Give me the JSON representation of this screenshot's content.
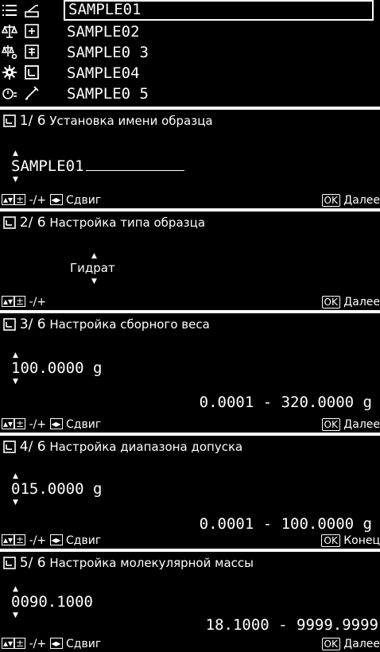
{
  "list_panel": {
    "items": [
      "SAMPLE01",
      "SAMPLE02",
      "SAMPLE0 3",
      "SAMPLE04",
      "SAMPLE0 5"
    ],
    "selected_index": 0,
    "left_icons": [
      "menu-list-icon",
      "balance-icon",
      "balance-settings-icon",
      "gear-icon",
      "timer-settings-icon"
    ],
    "right_icons": [
      "weighing-pan-icon",
      "sample-calc-icon",
      "sample-calc-alt-icon",
      "sample-box-icon",
      "pen-icon"
    ]
  },
  "panels": [
    {
      "step": "1/ 6",
      "title": "Установка имени образца",
      "value": "SAMPLE01",
      "footer_left_keys": "-/+",
      "footer_shift": "Сдвиг",
      "footer_ok": "OK",
      "footer_right_label": "Далее"
    },
    {
      "step": "2/ 6",
      "title": "Настройка типа образца",
      "value": "Гидрат",
      "footer_left_keys": "-/+",
      "footer_ok": "OK",
      "footer_right_label": "Далее"
    },
    {
      "step": "3/ 6",
      "title": "Настройка сборного веса",
      "value": "100.0000 g",
      "range": "0.0001 - 320.0000 g",
      "footer_left_keys": "-/+",
      "footer_shift": "Сдвиг",
      "footer_ok": "OK",
      "footer_right_label": "Далее"
    },
    {
      "step": "4/ 6",
      "title": "Настройка диапазона допуска",
      "value": "015.0000 g",
      "range": "0.0001 - 100.0000 g",
      "footer_left_keys": "-/+",
      "footer_shift": "Сдвиг",
      "footer_ok": "OK",
      "footer_right_label": "Конец"
    },
    {
      "step": "5/ 6",
      "title": "Настройка молекулярной массы",
      "value": "0090.1000",
      "range": "18.1000 - 9999.9999",
      "footer_left_keys": "-/+",
      "footer_shift": "Сдвиг",
      "footer_ok": "OK",
      "footer_right_label": "Далее"
    }
  ]
}
